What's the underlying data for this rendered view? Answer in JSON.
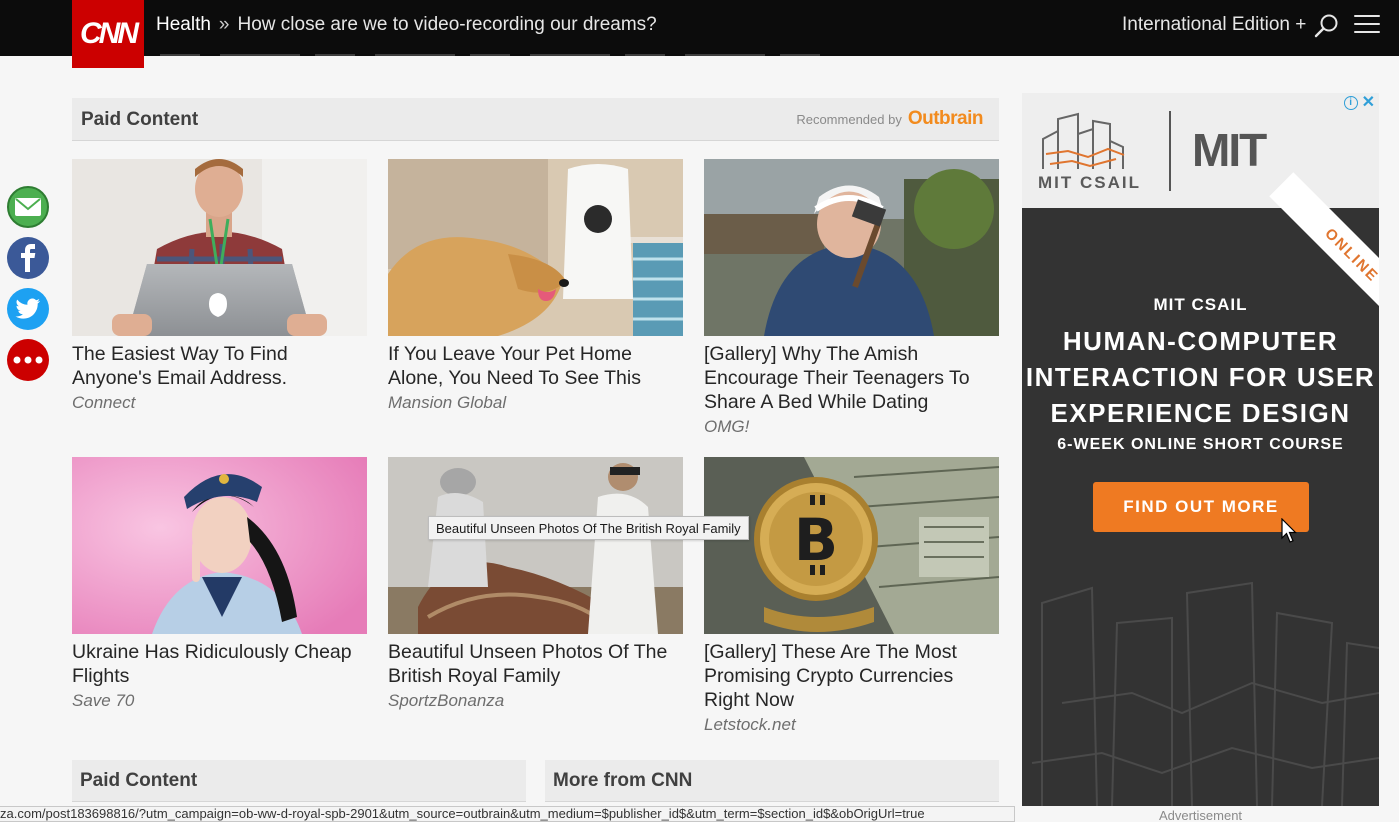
{
  "header": {
    "logo_text": "CNN",
    "section": "Health",
    "separator": "»",
    "article_title": "How close are we to video-recording our dreams?",
    "edition": "International Edition +",
    "search_icon": "search-icon",
    "menu_icon": "hamburger-menu-icon"
  },
  "share": [
    {
      "name": "email",
      "icon": "email-icon",
      "color": "#4caf50"
    },
    {
      "name": "facebook",
      "icon": "facebook-icon",
      "color": "#3b5998"
    },
    {
      "name": "twitter",
      "icon": "twitter-icon",
      "color": "#1da1f2"
    },
    {
      "name": "more",
      "icon": "more-icon",
      "color": "#cc0000"
    }
  ],
  "paid_content": {
    "title": "Paid Content",
    "recommended_by": "Recommended by",
    "brand": "Outbrain",
    "cards": [
      {
        "headline": "The Easiest Way To Find Anyone's Email Address.",
        "source": "Connect"
      },
      {
        "headline": "If You Leave Your Pet Home Alone, You Need To See This",
        "source": "Mansion Global"
      },
      {
        "headline": "[Gallery] Why The Amish Encourage Their Teenagers To Share A Bed While Dating",
        "source": "OMG!"
      },
      {
        "headline": "Ukraine Has Ridiculously Cheap Flights",
        "source": "Save 70"
      },
      {
        "headline": "Beautiful Unseen Photos Of The British Royal Family",
        "source": "SportzBonanza"
      },
      {
        "headline": "[Gallery] These Are The Most Promising Crypto Currencies Right Now",
        "source": "Letstock.net"
      }
    ]
  },
  "tooltip": "Beautiful Unseen Photos Of The British Royal Family",
  "bottom": {
    "paid_content_title": "Paid Content",
    "more_from_title": "More from CNN"
  },
  "status_url": "za.com/post183698816/?utm_campaign=ob-ww-d-royal-spb-2901&utm_source=outbrain&utm_medium=$publisher_id$&utm_term=$section_id$&obOrigUrl=true",
  "ad": {
    "logo_left": "MIT CSAIL",
    "logo_right": "MIT",
    "ribbon": "ONLINE",
    "kicker": "MIT CSAIL",
    "headline": "HUMAN-COMPUTER INTERACTION FOR USER EXPERIENCE DESIGN",
    "subhead": "6-WEEK ONLINE SHORT COURSE",
    "cta": "FIND OUT MORE",
    "label": "Advertisement",
    "accent": "#ef7a22"
  }
}
